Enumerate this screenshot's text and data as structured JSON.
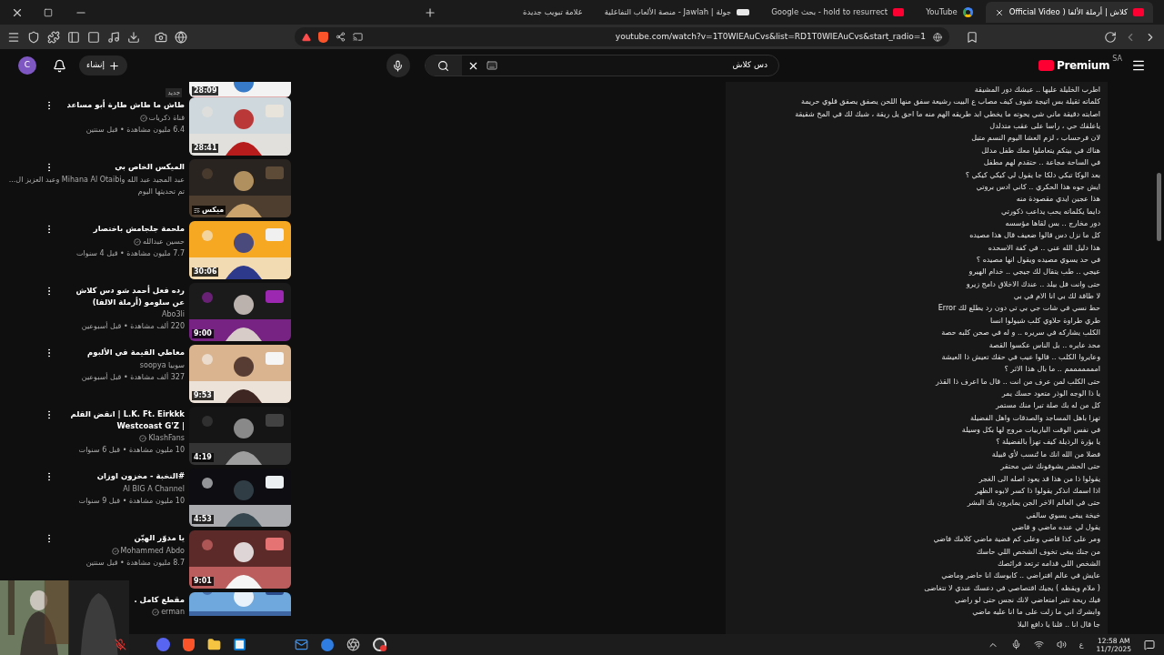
{
  "browser": {
    "tabs": [
      {
        "title": "كلاش | أرملة الألفا ( Official Video",
        "selected": true,
        "kind": "youtube"
      },
      {
        "title": "YouTube",
        "selected": false,
        "kind": "google"
      },
      {
        "title": "hold to resurrect - بحث Google",
        "selected": false,
        "kind": "search"
      },
      {
        "title": "جولة | Jawlah - منصة الألعاب التفاعلية",
        "selected": false,
        "kind": "site"
      },
      {
        "title": "علامة تبويب جديدة",
        "selected": false,
        "kind": "blank"
      }
    ],
    "url": "youtube.com/watch?v=1T0WIEAuCvs&list=RD1T0WIEAuCvs&start_radio=1"
  },
  "header": {
    "avatar": "C",
    "create": "إنشاء",
    "search": {
      "value": "دس كلاش"
    },
    "logo": "Premium",
    "region": "SA"
  },
  "videos": [
    {
      "kind": "partial",
      "duration": "28:09",
      "badge": "جديد"
    },
    {
      "kind": "video",
      "title": "طاش ما طاش طارة أبو مساعد",
      "channel": "قناة ذكريات",
      "verified": true,
      "meta": "6.4 مليون مشاهدة • قبل سنتين",
      "duration": "28:41"
    },
    {
      "kind": "mix",
      "title": "الميكس الخاص بي",
      "channel": "عبد المجيد عبد الله وMihana Al Otaibi وعبد العزيز ال...",
      "meta": "تم تحديثها اليوم",
      "duration": "ميكس"
    },
    {
      "kind": "video",
      "title": "ملحمة جلجامش باختصار",
      "channel": "حسين عبدالله",
      "verified": true,
      "meta": "7.7 مليون مشاهدة • قبل 4 سنوات",
      "duration": "30:06"
    },
    {
      "kind": "video",
      "title": "رده فعل أحمد شو دس كلاش عن سلومو (أرملة الالفا)",
      "channel": "Abo3li",
      "meta": "220 ألف مشاهدة • قبل أسبوعين",
      "duration": "9:00"
    },
    {
      "kind": "video",
      "title": "معاطي القيمة في الألبوم",
      "channel": "سوبيا soopya",
      "meta": "327 ألف مشاهدة • قبل أسبوعين",
      "duration": "9:53"
    },
    {
      "kind": "video",
      "title": "L.K. Ft. Eirkkk | انقض القلم | Westcoast G'Z",
      "channel": "KlashFans",
      "verified": true,
      "meta": "10 مليون مشاهدة • قبل 6 سنوات",
      "duration": "4:19"
    },
    {
      "kind": "video",
      "title": "#النخبة - مخزون اوزان",
      "channel": "Al BIG A Channel",
      "meta": "10 مليون مشاهدة • قبل 9 سنوات",
      "duration": "4:53"
    },
    {
      "kind": "video",
      "title": "يا مدوّر الهيّن",
      "channel": "Mohammed Abdo",
      "verified": true,
      "meta": "8.7 مليون مشاهدة • قبل سنتين",
      "duration": "9:01"
    },
    {
      "kind": "cut",
      "title": "مقطع كامل .",
      "channel": "erman",
      "verified": true
    }
  ],
  "lyrics": [
    "اطرب الخليلة عليها .. عيشك دور المشيقة",
    "كلماته ثقيلة بس اتيجة شوف كيف مصاب ع البيت رشيعة سفق منها اللحن يصفق يصفق قلوي حريمة",
    "اصابته دقيقة ماني شي يحوته ما يخطي ابد طريقه الهم منه ما احق يل ريقة ، شبك لك في المخ شقيقة",
    "ياعلقك حي ، راسا على عقب متدلدل",
    "لان فرحساب ، لزم العشا اليوم النسم متبل",
    "هناك في بيتكم يتعاملوا معك طفل مدلل",
    "في الساحة مجاعة .. حتقدم لهم مطفل",
    "بعد الوكا تبكي دلكا جا يقول لي كيكي كيكي ؟",
    "ايش جوه هذا الحكري .. كاني ادس بروتي",
    "هذا عجين ايدي مقصودة منه",
    "دايما يكلماته يحب يداعب ذكورتي",
    "دور مخارج .. بس لقاها مؤسسه",
    "كل ما نزل دس قالوا ضعيف قال هذا مصيده",
    "هذا دليل الله عني .. في كفة الاسحده",
    "في حد يسوي مصيده ويقول انها مصيده ؟",
    "عيجي .. طب يتقال لك جيجي .. خدام الهيرو",
    "حتى وانت فل بيلد .. عندك الاخلاق دامج زيرو",
    "لا طاقة لك بي انا الام في بي",
    "حط نسي في شات جي بي تي دون رد يطلع لك Error",
    "طري طراوة حلاوي كلب شيولوا انسا",
    "الكلب يشاركه في سريره .. و له في صحن كلبه حصة",
    "محد عايره .. بل الناس عكسوا القصة",
    "وعايروا الكلب .. قالوا عيب في حقك تعيش ذا العيشة",
    "امممممممم .. ما بال هذا الاثر ؟",
    "حتى الكلب لمن عرف من انت .. قال ما اعرف ذا القذر",
    "يا ذا الوجه الوذر متعود حسك يمر",
    "كل من له بك صلة تبرا منك مستمر",
    "تهزا باهل المساجد والصدقات واهل الفضيلة",
    "في نفس الوقت الباربيات مروج لها بكل وسيلة",
    "يا بؤرة الرذيلة كيف تهزأ بالفضيلة ؟",
    "فضلا من الله انك ما تُنسب لأي قبيلة",
    "حتى الحشر يشوفونك شي محتقر",
    "يقولوا ذا من هذا قد يعود اصله الى الغجر",
    "اذا اسمك انذكر يقولوا ذا كسر لابوه الظهر",
    "حتى في العالم الاخر الجن يمايرون بك البشر",
    "خيخة يبغى يسوي سالفي",
    "يقول لي عنده ماضي و قاضي",
    "ومر على كذا قاضي وعلى كم قضية ماضي كلامك فاضي",
    "من جنك يبغى تخوف الشخص اللي حاسك",
    "الشخص اللي قدامه ترتعد فرائصك",
    "عايش في عالم افتراضي .. كابوسك انا حاضر وماضي",
    "( ملام ويقظه ) يجيك اقتصاصي في دعسك عندي لا تتغاضى",
    "فيك ريحة تثير امتعاضي لانك نجس حتى لو راضي",
    "وابشرك اني ما زلت على ما انا عليه ماضي",
    "جا قال انا .. قلنا يا دافع البلا"
  ],
  "taskbar": {
    "language": "ع",
    "time": "12:58 AM",
    "date": "11/7/2025"
  }
}
